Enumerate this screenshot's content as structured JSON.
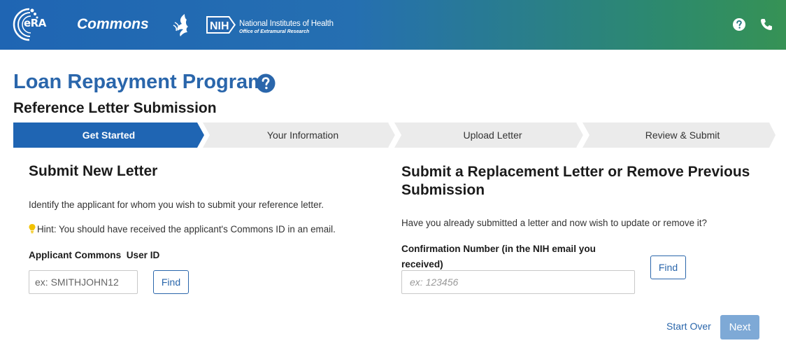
{
  "header": {
    "era_logo_text": "eRA",
    "app_name": "Commons",
    "nih_badge": "NIH",
    "nih_name": "National Institutes of Health",
    "nih_office": "Office of Extramural Research",
    "icons": [
      "help-icon",
      "phone-icon"
    ]
  },
  "page": {
    "title": "Loan Repayment Program",
    "subtitle": "Reference Letter Submission"
  },
  "stepper": {
    "steps": [
      {
        "label": "Get Started",
        "active": true
      },
      {
        "label": "Your Information",
        "active": false
      },
      {
        "label": "Upload Letter",
        "active": false
      },
      {
        "label": "Review & Submit",
        "active": false
      }
    ]
  },
  "new_letter": {
    "heading": "Submit New Letter",
    "description": "Identify the applicant for whom you wish to submit your reference letter.",
    "hint": "Hint: You should have received the applicant's Commons ID in an email.",
    "field_label": "Applicant Commons  User ID",
    "placeholder": "ex: SMITHJOHN12",
    "find_label": "Find"
  },
  "replacement": {
    "heading": "Submit a Replacement Letter or Remove Previous Submission",
    "description": "Have you already submitted a letter and now wish to update or remove it?",
    "field_label": "Confirmation Number (in the NIH email you received)",
    "placeholder": "ex: 123456",
    "find_label": "Find"
  },
  "actions": {
    "start_over": "Start Over",
    "next": "Next"
  },
  "colors": {
    "brand_blue": "#2a66ab",
    "header_start": "#1f65b3",
    "header_end": "#369255",
    "step_active": "#1f65b3",
    "step_inactive": "#ebebeb",
    "next_disabled": "#7ea9d6",
    "hint_bulb": "#f2c200"
  }
}
